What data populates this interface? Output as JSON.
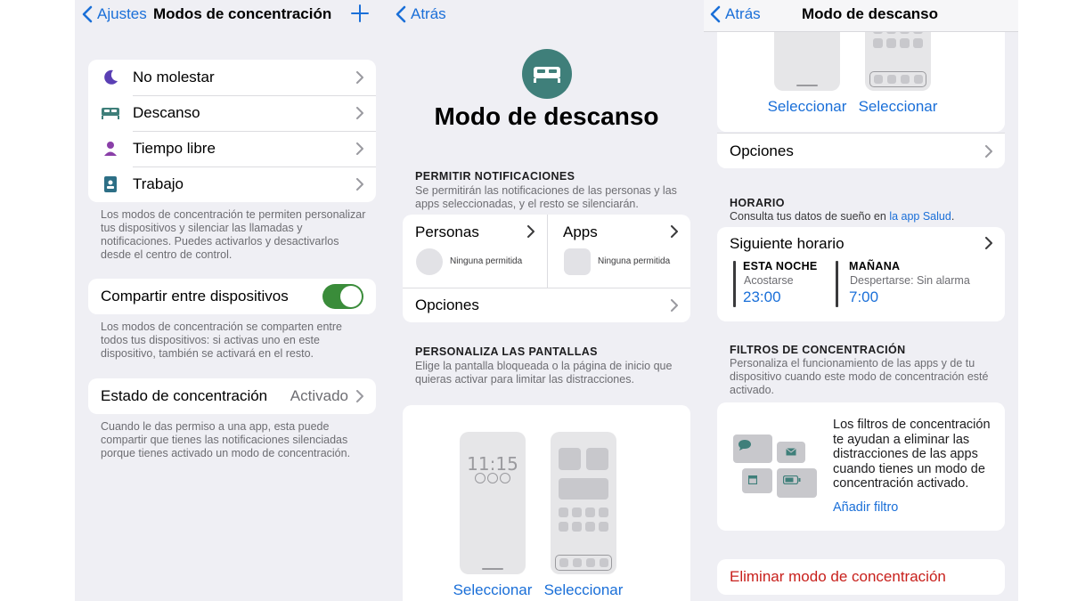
{
  "panel1": {
    "back_label": "Ajustes",
    "title": "Modos de concentración",
    "modes": [
      {
        "label": "No molestar",
        "icon": "moon-icon"
      },
      {
        "label": "Descanso",
        "icon": "bed-icon"
      },
      {
        "label": "Tiempo libre",
        "icon": "person-icon"
      },
      {
        "label": "Trabajo",
        "icon": "badge-icon"
      }
    ],
    "modes_footer": "Los modos de concentración te permiten personalizar tus dispositivos y silenciar las llamadas y notificaciones. Puedes activarlos y desactivarlos desde el centro de control.",
    "share_label": "Compartir entre dispositivos",
    "share_on": true,
    "share_footer": "Los modos de concentración se comparten entre todos tus dispositivos: si activas uno en este dispositivo, también se activará en el resto.",
    "status_label": "Estado de concentración",
    "status_value": "Activado",
    "status_footer": "Cuando le das permiso a una app, esta puede compartir que tienes las notificaciones silenciadas porque tienes activado un modo de concentración."
  },
  "panel2": {
    "back_label": "Atrás",
    "title": "Modo de descanso",
    "allow_header": "PERMITIR NOTIFICACIONES",
    "allow_desc": "Se permitirán las notificaciones de las personas y las apps seleccionadas, y el resto se silenciarán.",
    "people_label": "Personas",
    "people_sub": "Ninguna permitida",
    "apps_label": "Apps",
    "apps_sub": "Ninguna permitida",
    "options_label": "Opciones",
    "screens_header": "PERSONALIZA LAS PANTALLAS",
    "screens_desc": "Elige la pantalla bloqueada o la página de inicio que quieras activar para limitar las distracciones.",
    "lock_time": "11:15",
    "select_lock": "Seleccionar",
    "select_home": "Seleccionar",
    "accent_color": "#3f7f7a"
  },
  "panel3": {
    "back_label": "Atrás",
    "title": "Modo de descanso",
    "select_lock": "Seleccionar",
    "select_home": "Seleccionar",
    "options_label": "Opciones",
    "schedule_header": "HORARIO",
    "schedule_desc": "Consulta tus datos de sueño en",
    "schedule_link": "la app Salud",
    "schedule_period": ".",
    "next_label": "Siguiente horario",
    "tonight_title": "ESTA NOCHE",
    "tonight_sub": "Acostarse",
    "tonight_time": "23:00",
    "morning_title": "MAÑANA",
    "morning_sub": "Despertarse: Sin alarma",
    "morning_time": "7:00",
    "filters_header": "FILTROS DE CONCENTRACIÓN",
    "filters_desc": "Personaliza el funcionamiento de las apps y de tu dispositivo cuando este modo de concentración esté activado.",
    "filters_card_text": "Los filtros de concentración te ayudan a eliminar las distracciones de las apps cuando tienes un modo de concentración activado.",
    "add_filter": "Añadir filtro",
    "delete_label": "Eliminar modo de concentración",
    "delete_color": "#c8201c"
  }
}
